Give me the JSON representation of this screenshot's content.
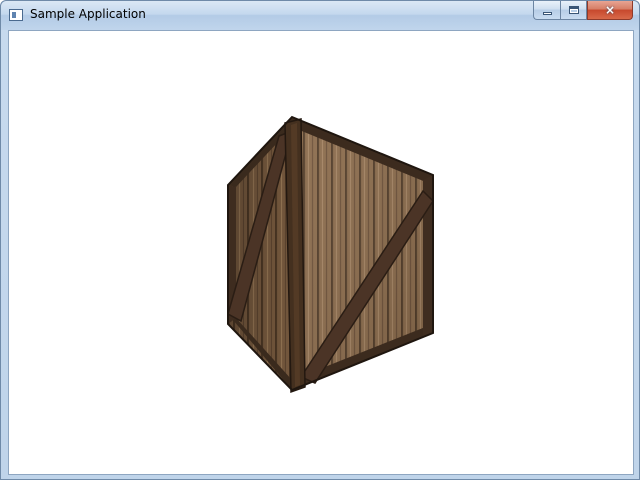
{
  "window": {
    "title": "Sample Application",
    "buttons": {
      "minimize": "minimize",
      "maximize": "maximize",
      "close": "×"
    }
  },
  "scene": {
    "object": "wooden-crate",
    "colors": {
      "wood_light": "#8a6a4a",
      "wood_dark": "#4a3522",
      "strap": "#4b3426",
      "strap_edge": "#2a1d14",
      "background": "#ffffff"
    }
  }
}
